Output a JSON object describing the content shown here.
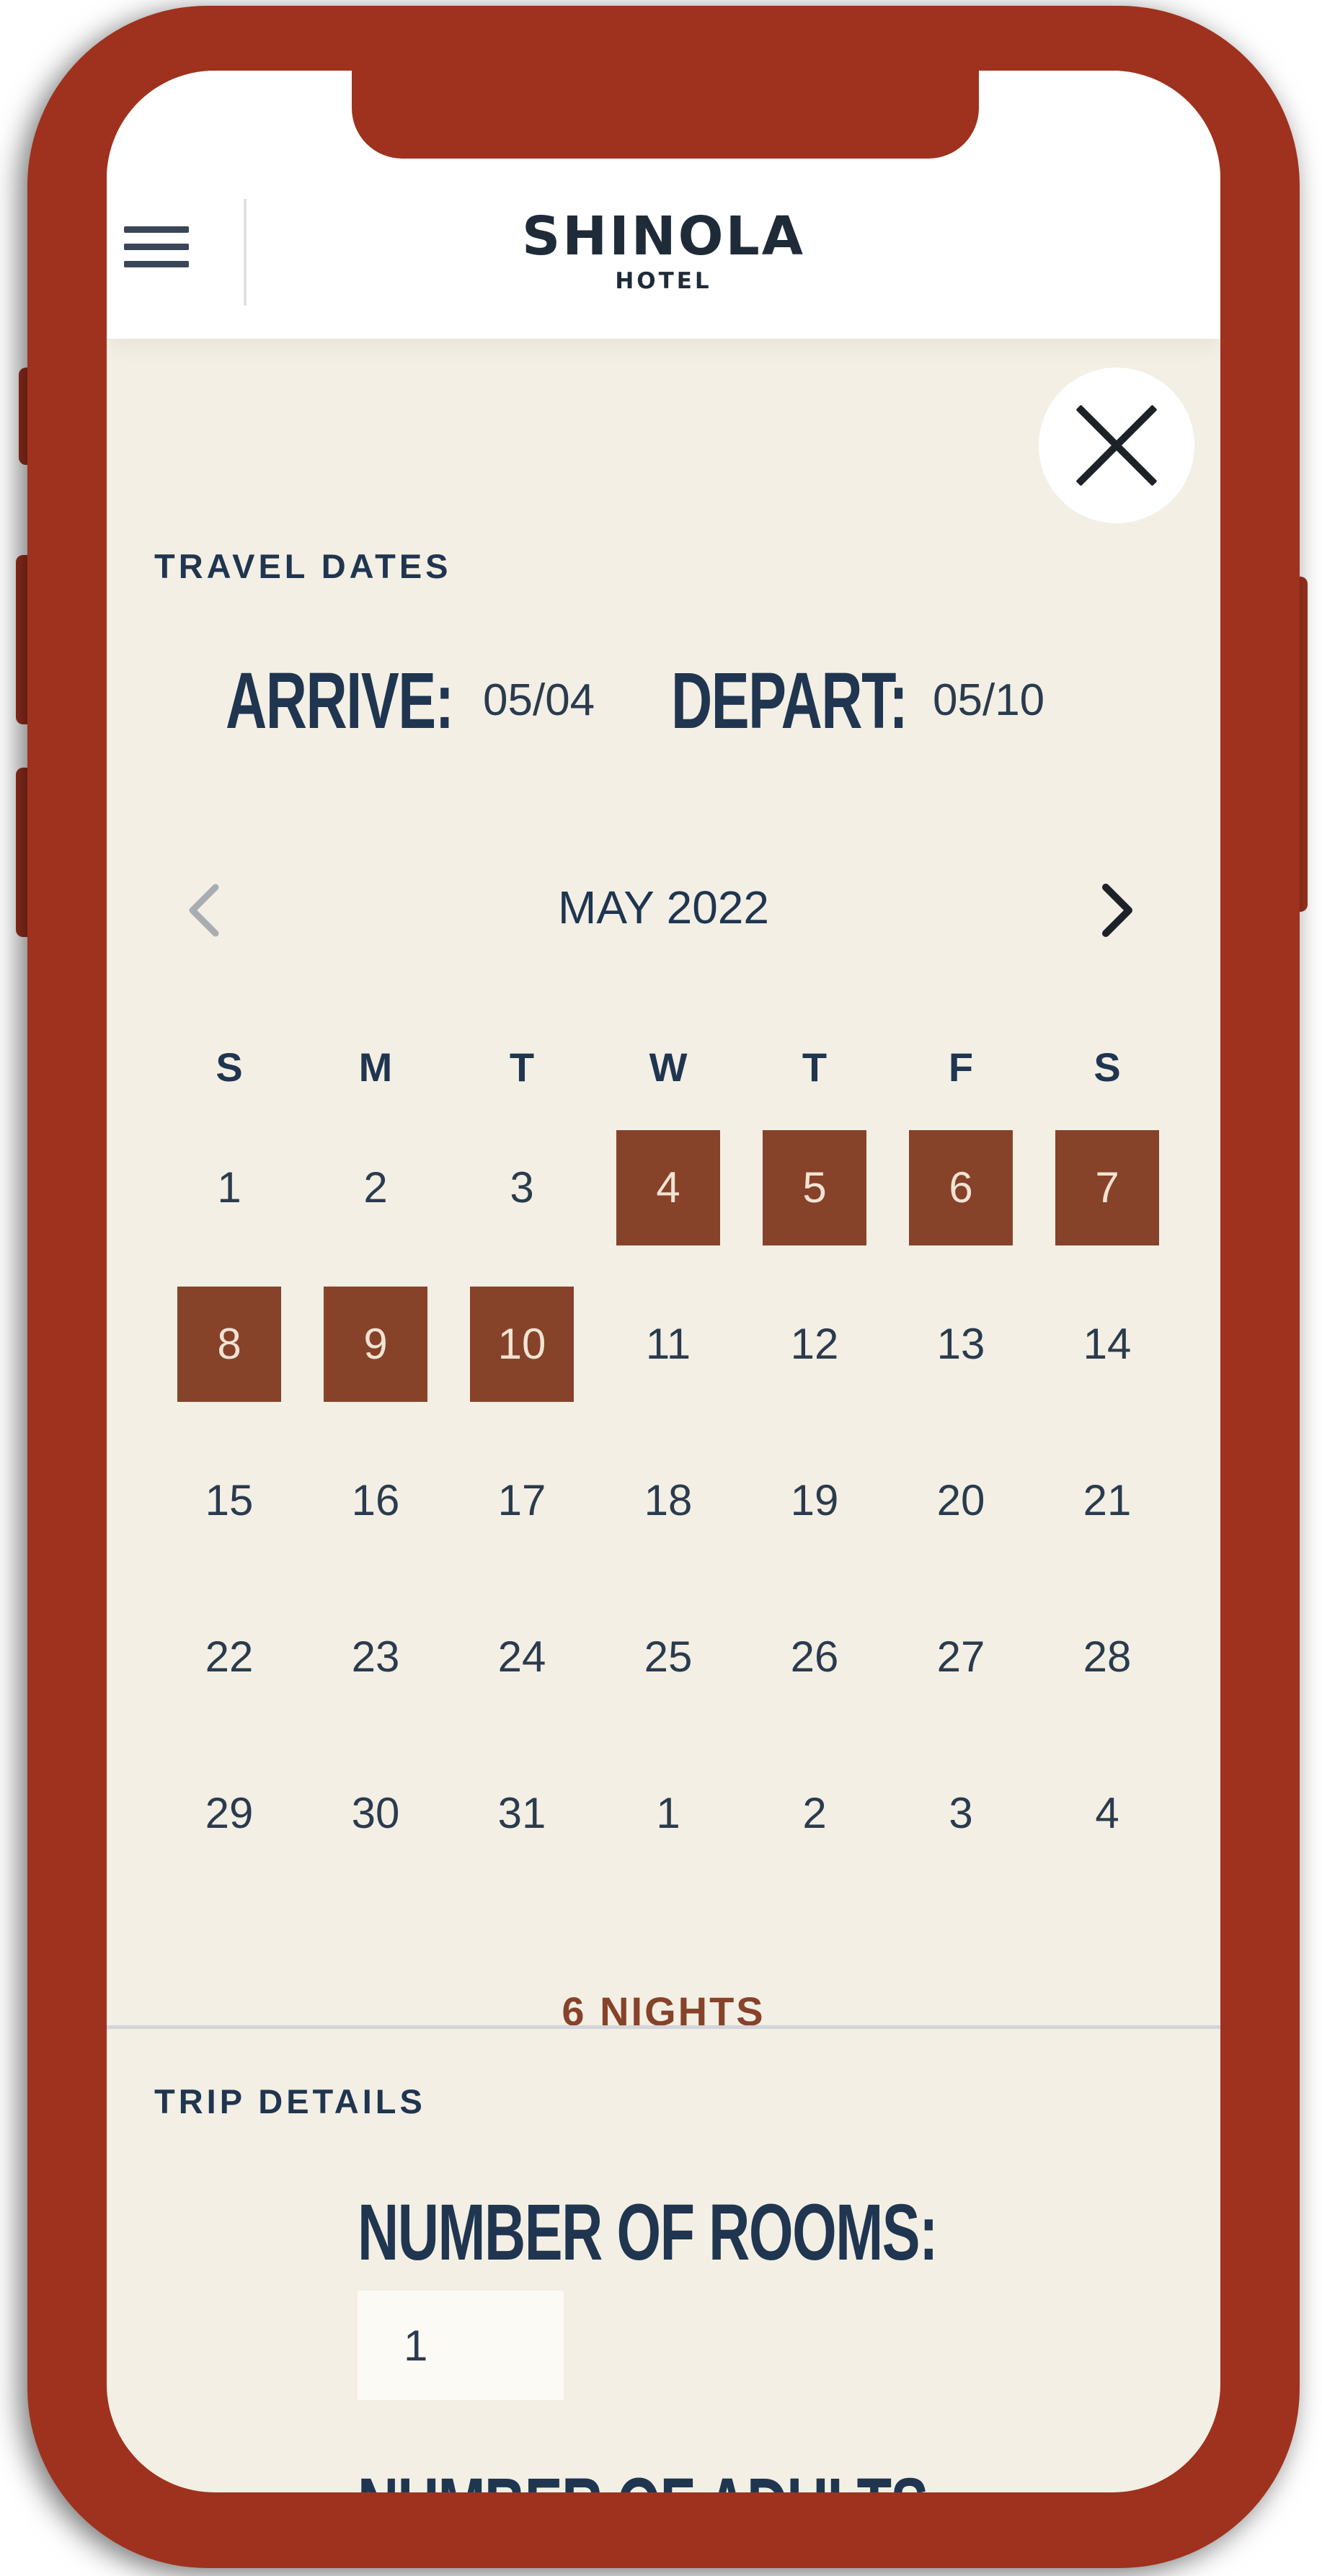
{
  "header": {
    "logo_main": "SHINOLA",
    "logo_sub": "HOTEL"
  },
  "travel": {
    "section_label": "TRAVEL DATES",
    "arrive_label": "ARRIVE:",
    "arrive_value": "05/04",
    "depart_label": "DEPART:",
    "depart_value": "05/10"
  },
  "calendar": {
    "month_label": "MAY 2022",
    "weekdays": [
      "S",
      "M",
      "T",
      "W",
      "T",
      "F",
      "S"
    ],
    "weeks": [
      [
        {
          "d": "1",
          "sel": false
        },
        {
          "d": "2",
          "sel": false
        },
        {
          "d": "3",
          "sel": false
        },
        {
          "d": "4",
          "sel": true
        },
        {
          "d": "5",
          "sel": true
        },
        {
          "d": "6",
          "sel": true
        },
        {
          "d": "7",
          "sel": true
        }
      ],
      [
        {
          "d": "8",
          "sel": true
        },
        {
          "d": "9",
          "sel": true
        },
        {
          "d": "10",
          "sel": true
        },
        {
          "d": "11",
          "sel": false
        },
        {
          "d": "12",
          "sel": false
        },
        {
          "d": "13",
          "sel": false
        },
        {
          "d": "14",
          "sel": false
        }
      ],
      [
        {
          "d": "15",
          "sel": false
        },
        {
          "d": "16",
          "sel": false
        },
        {
          "d": "17",
          "sel": false
        },
        {
          "d": "18",
          "sel": false
        },
        {
          "d": "19",
          "sel": false
        },
        {
          "d": "20",
          "sel": false
        },
        {
          "d": "21",
          "sel": false
        }
      ],
      [
        {
          "d": "22",
          "sel": false
        },
        {
          "d": "23",
          "sel": false
        },
        {
          "d": "24",
          "sel": false
        },
        {
          "d": "25",
          "sel": false
        },
        {
          "d": "26",
          "sel": false
        },
        {
          "d": "27",
          "sel": false
        },
        {
          "d": "28",
          "sel": false
        }
      ],
      [
        {
          "d": "29",
          "sel": false
        },
        {
          "d": "30",
          "sel": false
        },
        {
          "d": "31",
          "sel": false
        },
        {
          "d": "1",
          "sel": false
        },
        {
          "d": "2",
          "sel": false
        },
        {
          "d": "3",
          "sel": false
        },
        {
          "d": "4",
          "sel": false
        }
      ]
    ],
    "nights_label": "6 NIGHTS"
  },
  "trip": {
    "section_label": "TRIP DETAILS",
    "rooms_label": "NUMBER OF ROOMS:",
    "rooms_value": "1",
    "adults_label": "NUMBER OF ADULTS"
  },
  "colors": {
    "frame": "#9e321e",
    "selected_day": "#87422a",
    "text_navy": "#1f3550",
    "panel_bg": "#f3efe4"
  },
  "icons": {
    "menu": "hamburger-icon",
    "close": "close-icon",
    "prev": "chevron-left-icon",
    "next": "chevron-right-icon"
  }
}
